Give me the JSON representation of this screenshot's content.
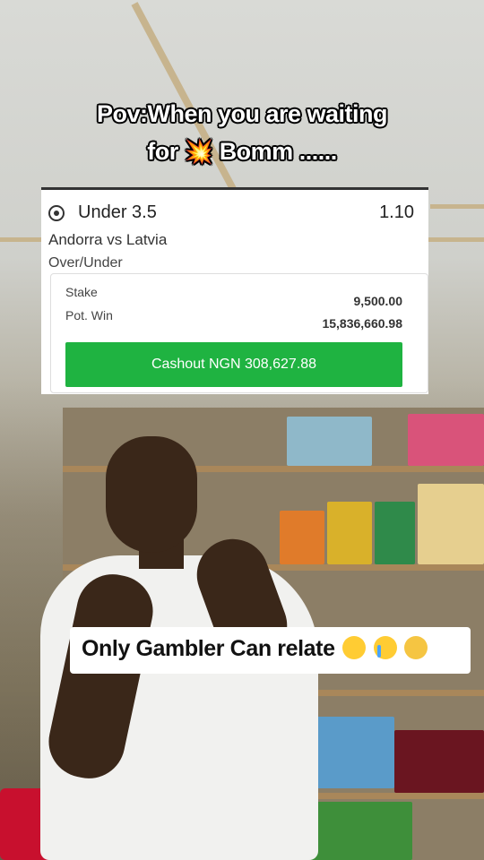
{
  "overlay": {
    "headline_line1": "Pov:When you are waiting",
    "headline_line2_prefix": "for",
    "headline_emoji": "💥",
    "headline_line2_suffix": "Bomm ......"
  },
  "bet_slip": {
    "sport_icon": "soccer-ball-icon",
    "market": "Under 3.5",
    "odds": "1.10",
    "match": "Andorra vs Latvia",
    "market_type": "Over/Under",
    "stake_label": "Stake",
    "stake_value": "9,500.00",
    "pot_win_label": "Pot. Win",
    "pot_win_value": "15,836,660.98",
    "cashout_label": "Cashout NGN 308,627.88",
    "cashout_color": "#1fb341"
  },
  "caption": {
    "text": "Only Gambler Can relate",
    "emojis": [
      "laughing-crying-emoji",
      "loudly-crying-emoji",
      "sad-sweat-emoji"
    ]
  }
}
